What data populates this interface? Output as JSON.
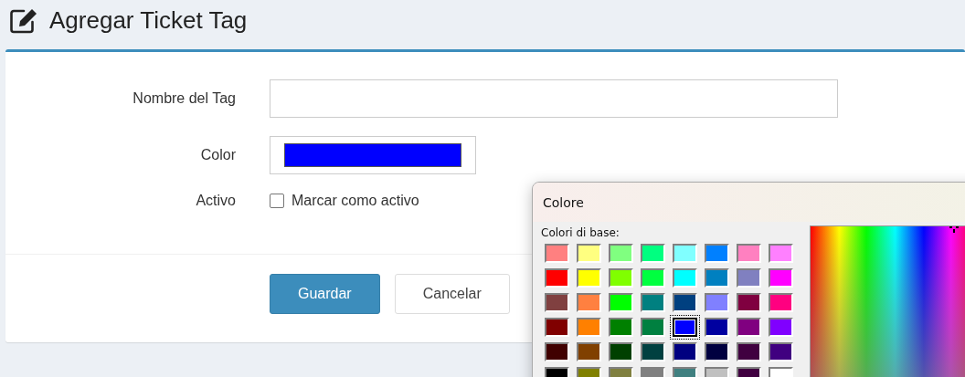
{
  "header": {
    "title": "Agregar Ticket Tag"
  },
  "form": {
    "fields": [
      {
        "kind": "text",
        "label": "Nombre del Tag"
      },
      {
        "kind": "color",
        "label": "Color",
        "color": "#0000ff"
      },
      {
        "kind": "checkbox",
        "label": "Activo",
        "option": "Marcar como activo",
        "checked": false
      }
    ],
    "buttons": [
      {
        "label": "Guardar",
        "kind": "primary"
      },
      {
        "label": "Cancelar",
        "kind": "default"
      }
    ]
  },
  "color_dialog": {
    "title": "Colore",
    "section": "Colori di base:",
    "swatches": [
      {
        "color": "#ff8080",
        "selected": false
      },
      {
        "color": "#ffff80",
        "selected": false
      },
      {
        "color": "#80ff80",
        "selected": false
      },
      {
        "color": "#00ff80",
        "selected": false
      },
      {
        "color": "#80ffff",
        "selected": false
      },
      {
        "color": "#0080ff",
        "selected": false
      },
      {
        "color": "#ff80c0",
        "selected": false
      },
      {
        "color": "#ff80ff",
        "selected": false
      },
      {
        "color": "#ff0000",
        "selected": false
      },
      {
        "color": "#ffff00",
        "selected": false
      },
      {
        "color": "#80ff00",
        "selected": false
      },
      {
        "color": "#00ff40",
        "selected": false
      },
      {
        "color": "#00ffff",
        "selected": false
      },
      {
        "color": "#0080c0",
        "selected": false
      },
      {
        "color": "#8080c0",
        "selected": false
      },
      {
        "color": "#ff00ff",
        "selected": false
      },
      {
        "color": "#804040",
        "selected": false
      },
      {
        "color": "#ff8040",
        "selected": false
      },
      {
        "color": "#00ff00",
        "selected": false
      },
      {
        "color": "#008080",
        "selected": false
      },
      {
        "color": "#004080",
        "selected": false
      },
      {
        "color": "#8080ff",
        "selected": false
      },
      {
        "color": "#800040",
        "selected": false
      },
      {
        "color": "#ff0080",
        "selected": false
      },
      {
        "color": "#800000",
        "selected": false
      },
      {
        "color": "#ff8000",
        "selected": false
      },
      {
        "color": "#008000",
        "selected": false
      },
      {
        "color": "#008040",
        "selected": false
      },
      {
        "color": "#0000ff",
        "selected": true
      },
      {
        "color": "#0000a0",
        "selected": false
      },
      {
        "color": "#800080",
        "selected": false
      },
      {
        "color": "#8000ff",
        "selected": false
      },
      {
        "color": "#400000",
        "selected": false
      },
      {
        "color": "#804000",
        "selected": false
      },
      {
        "color": "#004000",
        "selected": false
      },
      {
        "color": "#004040",
        "selected": false
      },
      {
        "color": "#000080",
        "selected": false
      },
      {
        "color": "#000040",
        "selected": false
      },
      {
        "color": "#400040",
        "selected": false
      },
      {
        "color": "#400080",
        "selected": false
      },
      {
        "color": "#000000",
        "selected": false
      },
      {
        "color": "#808000",
        "selected": false
      },
      {
        "color": "#808040",
        "selected": false
      },
      {
        "color": "#808080",
        "selected": false
      },
      {
        "color": "#408080",
        "selected": false
      },
      {
        "color": "#c0c0c0",
        "selected": false
      },
      {
        "color": "#400040",
        "selected": false
      },
      {
        "color": "#ffffff",
        "selected": false
      }
    ]
  }
}
